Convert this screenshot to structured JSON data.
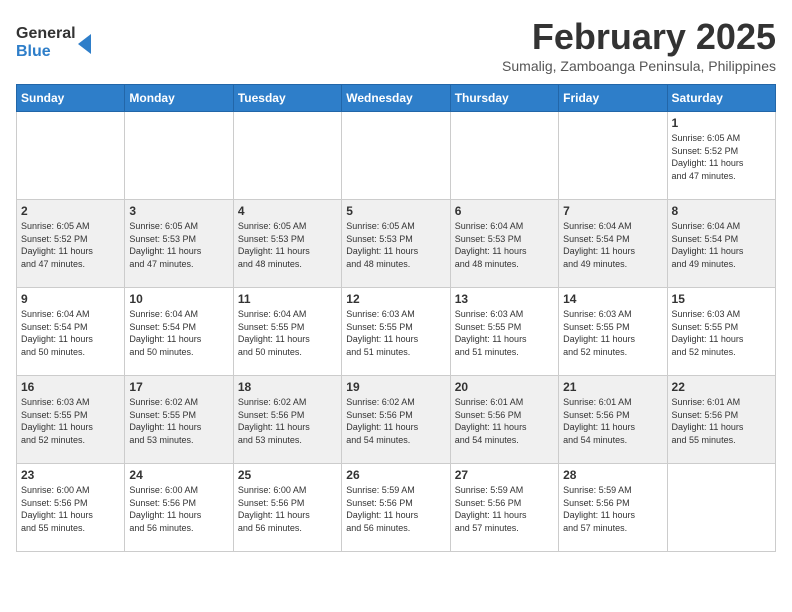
{
  "header": {
    "logo_general": "General",
    "logo_blue": "Blue",
    "month_title": "February 2025",
    "subtitle": "Sumalig, Zamboanga Peninsula, Philippines"
  },
  "weekdays": [
    "Sunday",
    "Monday",
    "Tuesday",
    "Wednesday",
    "Thursday",
    "Friday",
    "Saturday"
  ],
  "weeks": [
    [
      {
        "day": "",
        "info": ""
      },
      {
        "day": "",
        "info": ""
      },
      {
        "day": "",
        "info": ""
      },
      {
        "day": "",
        "info": ""
      },
      {
        "day": "",
        "info": ""
      },
      {
        "day": "",
        "info": ""
      },
      {
        "day": "1",
        "info": "Sunrise: 6:05 AM\nSunset: 5:52 PM\nDaylight: 11 hours\nand 47 minutes."
      }
    ],
    [
      {
        "day": "2",
        "info": "Sunrise: 6:05 AM\nSunset: 5:52 PM\nDaylight: 11 hours\nand 47 minutes."
      },
      {
        "day": "3",
        "info": "Sunrise: 6:05 AM\nSunset: 5:53 PM\nDaylight: 11 hours\nand 47 minutes."
      },
      {
        "day": "4",
        "info": "Sunrise: 6:05 AM\nSunset: 5:53 PM\nDaylight: 11 hours\nand 48 minutes."
      },
      {
        "day": "5",
        "info": "Sunrise: 6:05 AM\nSunset: 5:53 PM\nDaylight: 11 hours\nand 48 minutes."
      },
      {
        "day": "6",
        "info": "Sunrise: 6:04 AM\nSunset: 5:53 PM\nDaylight: 11 hours\nand 48 minutes."
      },
      {
        "day": "7",
        "info": "Sunrise: 6:04 AM\nSunset: 5:54 PM\nDaylight: 11 hours\nand 49 minutes."
      },
      {
        "day": "8",
        "info": "Sunrise: 6:04 AM\nSunset: 5:54 PM\nDaylight: 11 hours\nand 49 minutes."
      }
    ],
    [
      {
        "day": "9",
        "info": "Sunrise: 6:04 AM\nSunset: 5:54 PM\nDaylight: 11 hours\nand 50 minutes."
      },
      {
        "day": "10",
        "info": "Sunrise: 6:04 AM\nSunset: 5:54 PM\nDaylight: 11 hours\nand 50 minutes."
      },
      {
        "day": "11",
        "info": "Sunrise: 6:04 AM\nSunset: 5:55 PM\nDaylight: 11 hours\nand 50 minutes."
      },
      {
        "day": "12",
        "info": "Sunrise: 6:03 AM\nSunset: 5:55 PM\nDaylight: 11 hours\nand 51 minutes."
      },
      {
        "day": "13",
        "info": "Sunrise: 6:03 AM\nSunset: 5:55 PM\nDaylight: 11 hours\nand 51 minutes."
      },
      {
        "day": "14",
        "info": "Sunrise: 6:03 AM\nSunset: 5:55 PM\nDaylight: 11 hours\nand 52 minutes."
      },
      {
        "day": "15",
        "info": "Sunrise: 6:03 AM\nSunset: 5:55 PM\nDaylight: 11 hours\nand 52 minutes."
      }
    ],
    [
      {
        "day": "16",
        "info": "Sunrise: 6:03 AM\nSunset: 5:55 PM\nDaylight: 11 hours\nand 52 minutes."
      },
      {
        "day": "17",
        "info": "Sunrise: 6:02 AM\nSunset: 5:55 PM\nDaylight: 11 hours\nand 53 minutes."
      },
      {
        "day": "18",
        "info": "Sunrise: 6:02 AM\nSunset: 5:56 PM\nDaylight: 11 hours\nand 53 minutes."
      },
      {
        "day": "19",
        "info": "Sunrise: 6:02 AM\nSunset: 5:56 PM\nDaylight: 11 hours\nand 54 minutes."
      },
      {
        "day": "20",
        "info": "Sunrise: 6:01 AM\nSunset: 5:56 PM\nDaylight: 11 hours\nand 54 minutes."
      },
      {
        "day": "21",
        "info": "Sunrise: 6:01 AM\nSunset: 5:56 PM\nDaylight: 11 hours\nand 54 minutes."
      },
      {
        "day": "22",
        "info": "Sunrise: 6:01 AM\nSunset: 5:56 PM\nDaylight: 11 hours\nand 55 minutes."
      }
    ],
    [
      {
        "day": "23",
        "info": "Sunrise: 6:00 AM\nSunset: 5:56 PM\nDaylight: 11 hours\nand 55 minutes."
      },
      {
        "day": "24",
        "info": "Sunrise: 6:00 AM\nSunset: 5:56 PM\nDaylight: 11 hours\nand 56 minutes."
      },
      {
        "day": "25",
        "info": "Sunrise: 6:00 AM\nSunset: 5:56 PM\nDaylight: 11 hours\nand 56 minutes."
      },
      {
        "day": "26",
        "info": "Sunrise: 5:59 AM\nSunset: 5:56 PM\nDaylight: 11 hours\nand 56 minutes."
      },
      {
        "day": "27",
        "info": "Sunrise: 5:59 AM\nSunset: 5:56 PM\nDaylight: 11 hours\nand 57 minutes."
      },
      {
        "day": "28",
        "info": "Sunrise: 5:59 AM\nSunset: 5:56 PM\nDaylight: 11 hours\nand 57 minutes."
      },
      {
        "day": "",
        "info": ""
      }
    ]
  ]
}
